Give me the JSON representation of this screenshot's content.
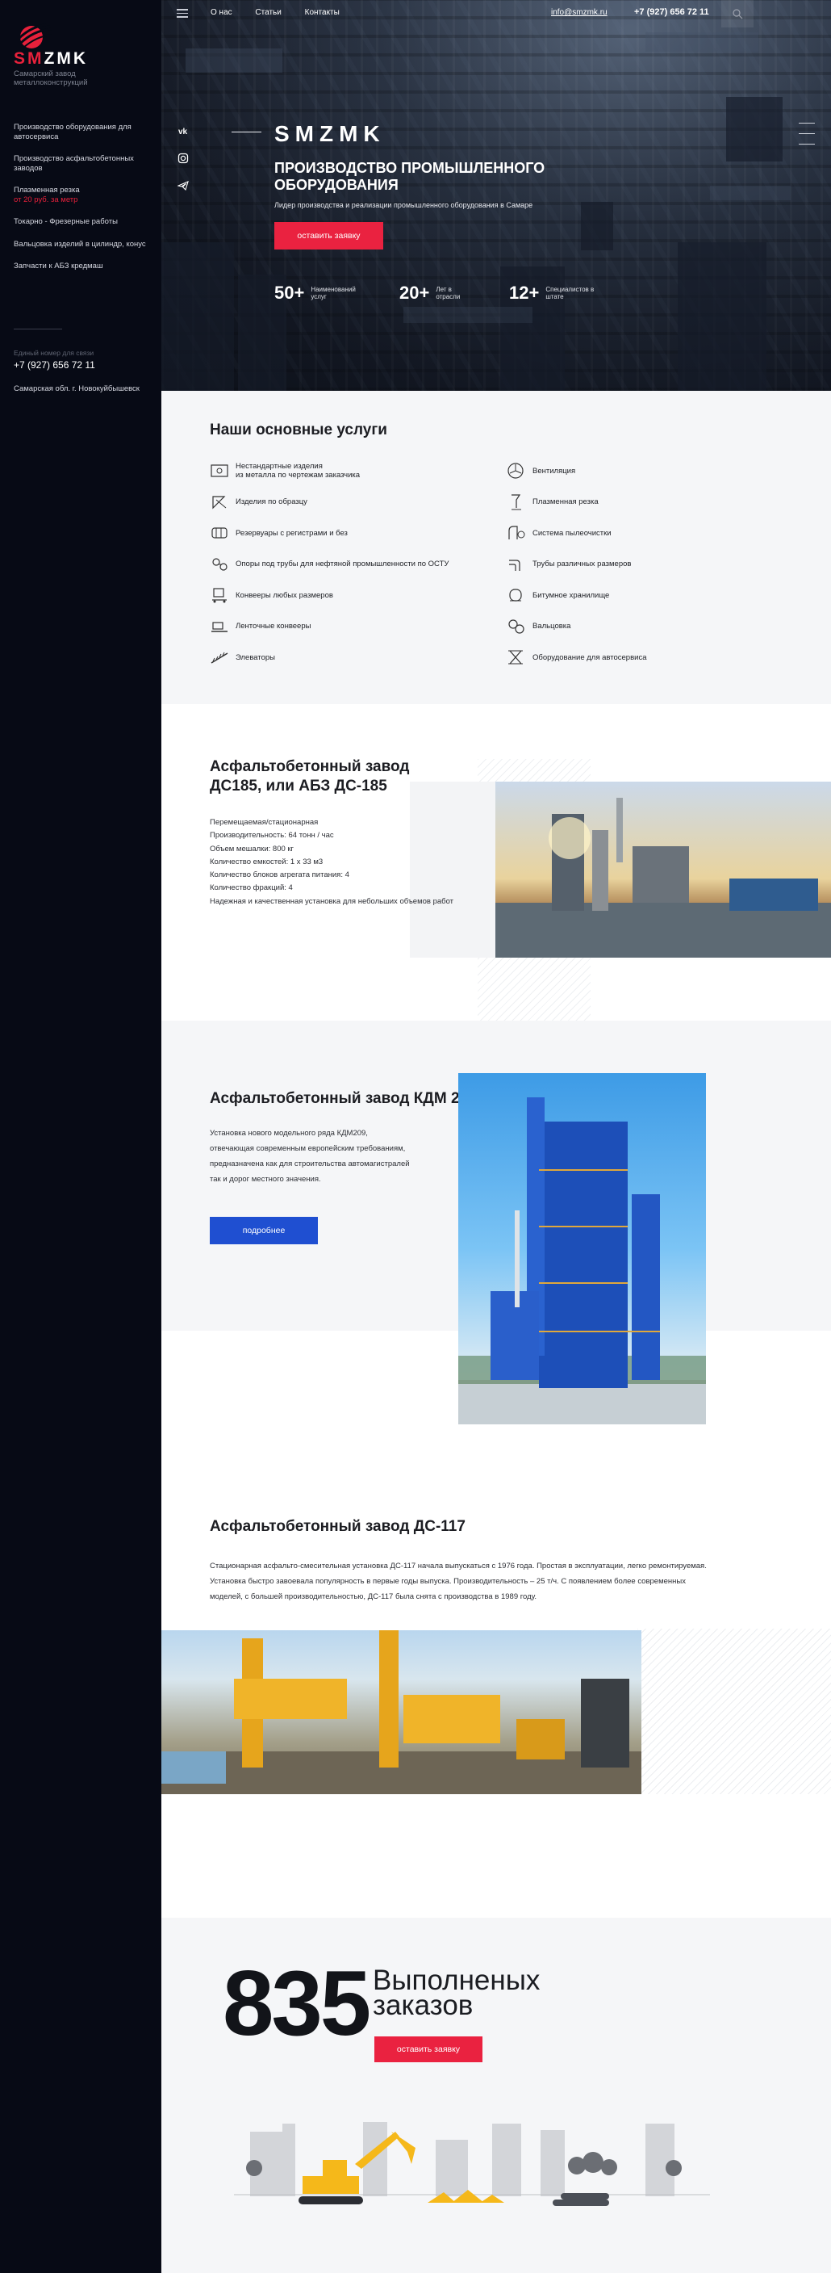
{
  "sidebar": {
    "logo_sub": "Самарский завод металлоконструкций",
    "nav": [
      {
        "label": "Производство оборудования для автосервиса"
      },
      {
        "label": "Производство асфальтобетонных заводов"
      },
      {
        "label": "Плазменная резка",
        "price": "от 20 руб. за метр"
      },
      {
        "label": "Токарно - Фрезерные работы"
      },
      {
        "label": "Вальцовка изделий в цилиндр, конус"
      },
      {
        "label": "Запчасти к АБЗ кредмаш"
      }
    ],
    "phone_caption": "Единый номер для связи",
    "phone": "+7 (927) 656 72 11",
    "address": "Самарская обл. г. Новокуйбышевск"
  },
  "topbar": {
    "nav": [
      "О нас",
      "Статьи",
      "Контакты"
    ],
    "email": "info@smzmk.ru",
    "phone": "+7 (927) 656 72 11"
  },
  "hero": {
    "brand": "SMZMK",
    "title": "ПРОИЗВОДСТВО ПРОМЫШЛЕННОГО ОБОРУДОВАНИЯ",
    "subtitle": "Лидер производства и реализации промышленного оборудования в Самаре",
    "button": "оставить заявку",
    "stats": [
      {
        "value": "50+",
        "label": "Наименований услуг"
      },
      {
        "value": "20+",
        "label": "Лет в отрасли"
      },
      {
        "value": "12+",
        "label": "Специалистов в штате"
      }
    ]
  },
  "services": {
    "title": "Наши основные услуги",
    "left": [
      {
        "icon": "sheet-metal-icon",
        "label": "Нестандартные изделия\nиз металла по чертежам заказчика"
      },
      {
        "icon": "template-icon",
        "label": "Изделия по образцу"
      },
      {
        "icon": "tank-icon",
        "label": "Резервуары с регистрами и без"
      },
      {
        "icon": "pipe-support-icon",
        "label": "Опоры под трубы для нефтяной промышленности по ОСТУ"
      },
      {
        "icon": "conveyor-icon",
        "label": "Конвееры любых размеров"
      },
      {
        "icon": "belt-conveyor-icon",
        "label": "Ленточные конвееры"
      },
      {
        "icon": "elevator-icon",
        "label": "Элеваторы"
      }
    ],
    "right": [
      {
        "icon": "fan-icon",
        "label": "Вентиляция"
      },
      {
        "icon": "plasma-cutter-icon",
        "label": "Плазменная резка"
      },
      {
        "icon": "dust-system-icon",
        "label": "Система пылеочистки"
      },
      {
        "icon": "pipes-icon",
        "label": "Трубы различных размеров"
      },
      {
        "icon": "bitumen-storage-icon",
        "label": "Битумное хранилище"
      },
      {
        "icon": "rolling-icon",
        "label": "Вальцовка"
      },
      {
        "icon": "car-lift-icon",
        "label": "Оборудование для автосервиса"
      }
    ]
  },
  "abz185": {
    "title": "Асфальтобетонный завод ДС185, или АБЗ ДС-185",
    "specs": [
      "Перемещаемая/стационарная",
      "Производительность: 64 тонн / час",
      "Объем мешалки: 800 кг",
      "Количество емкостей: 1 х 33 м3",
      "Количество блоков агрегата питания: 4",
      "Количество фракций: 4",
      "Надежная и качественная установка для небольших объемов работ"
    ]
  },
  "kdm209": {
    "title": "Асфальтобетонный завод КДМ 209",
    "text": [
      "Установка нового модельного ряда КДМ209,",
      "отвечающая современным европейским требованиям,",
      "предназначена как для строительства автомагистралей",
      "так и дорог местного значения."
    ],
    "button": "подробнее"
  },
  "ds117": {
    "title": "Асфальтобетонный завод ДС-117",
    "text": "Стационарная асфальто-смесительная установка ДС-117 начала выпускаться с 1976 года.   Простая в эксплуатации, легко ремонтируемая. Установка быстро завоевала популярность в первые годы выпуска.  Производительность – 25 т/ч. С появлением более современных моделей, с большей производительностью, ДС-117 была снята с производства в 1989 году."
  },
  "counter": {
    "value": "835",
    "label": "Выполненых заказов",
    "button": "оставить заявку"
  },
  "colors": {
    "accent_red": "#ea2240",
    "accent_blue": "#1f4fd1",
    "sidebar_bg": "#070a15"
  }
}
